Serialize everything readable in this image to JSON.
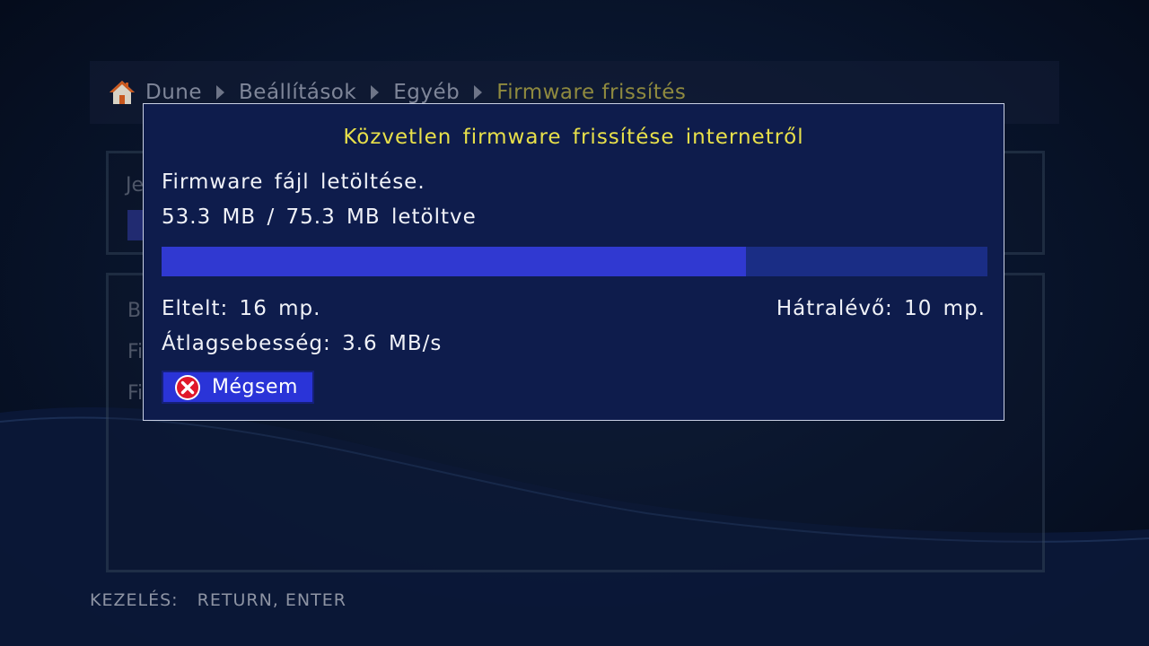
{
  "breadcrumb": {
    "items": [
      "Dune",
      "Beállítások",
      "Egyéb"
    ],
    "active": "Firmware frissítés"
  },
  "background_page": {
    "row1_label": "Je",
    "row2_label": "B",
    "row3_label": "Fi",
    "row4_label": "Fi"
  },
  "dialog": {
    "title": "Közvetlen firmware frissítése internetről",
    "status": "Firmware fájl letöltése.",
    "downloaded": "53.3 MB / 75.3 MB letöltve",
    "progress_fraction": 0.708,
    "elapsed": "Eltelt: 16 mp.",
    "remaining": "Hátralévő: 10 mp.",
    "avg_speed": "Átlagsebesség: 3.6 MB/s",
    "cancel_label": "Mégsem"
  },
  "footer": {
    "controls": "KEZELÉS:   RETURN, ENTER"
  },
  "colors": {
    "title_yellow": "#e8e04a",
    "progress_fill": "#3039d1",
    "progress_track": "#1a2d85",
    "dialog_bg": "#0e1c4c",
    "cancel_icon_red": "#e0182a"
  },
  "icons": {
    "home": "home-icon",
    "cancel": "close-circle-icon"
  }
}
